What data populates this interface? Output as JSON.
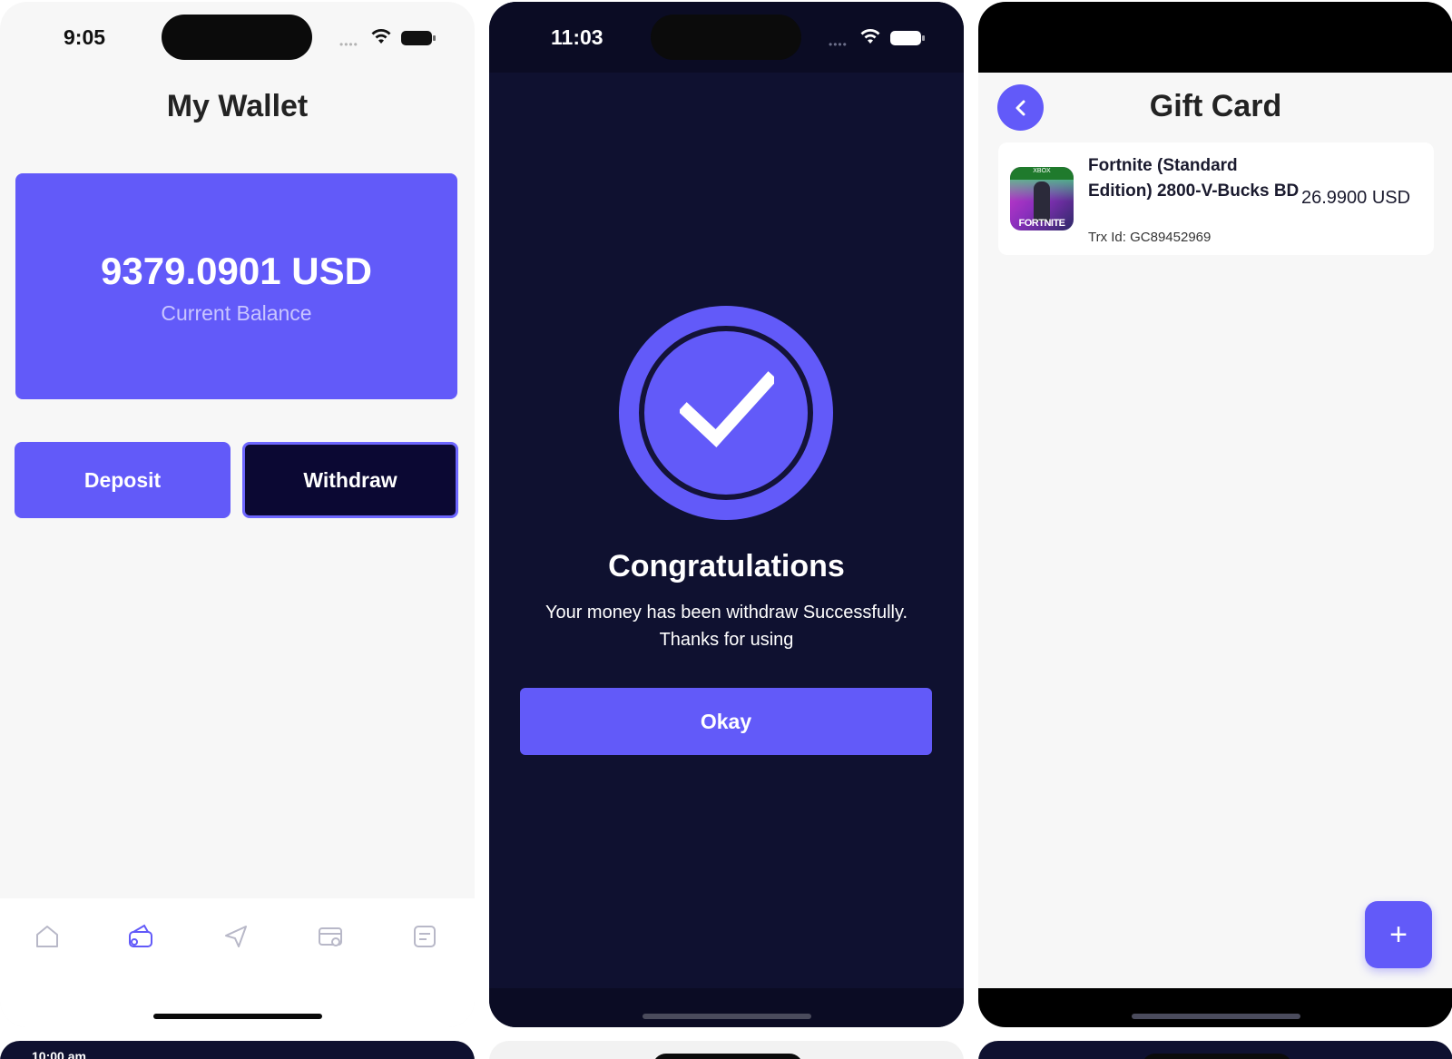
{
  "colors": {
    "accent": "#625af9",
    "dark_navy": "#0f1130",
    "withdraw_bg": "#0b0833",
    "light_bg": "#f7f7f7"
  },
  "wallet_screen": {
    "status_time": "9:05",
    "title": "My Wallet",
    "balance_amount": "9379.0901 USD",
    "balance_caption": "Current Balance",
    "deposit_label": "Deposit",
    "withdraw_label": "Withdraw",
    "tabs": [
      {
        "icon": "home-icon"
      },
      {
        "icon": "wallet-icon",
        "active": true
      },
      {
        "icon": "send-icon"
      },
      {
        "icon": "card-icon"
      },
      {
        "icon": "notes-icon"
      }
    ]
  },
  "success_screen": {
    "status_time": "11:03",
    "title": "Congratulations",
    "message_line1": "Your money has been withdraw Successfully.",
    "message_line2": "Thanks for using",
    "okay_label": "Okay"
  },
  "gift_card_screen": {
    "title": "Gift Card",
    "items": [
      {
        "name": "Fortnite (Standard Edition) 2800-V-Bucks BD",
        "trx": "Trx Id: GC89452969",
        "price": "26.9900 USD",
        "thumb_brand": "XBOX",
        "thumb_word": "FORTNITE"
      }
    ],
    "fab_label": "+"
  },
  "peek_screen": {
    "status_time": "10:00 am"
  }
}
